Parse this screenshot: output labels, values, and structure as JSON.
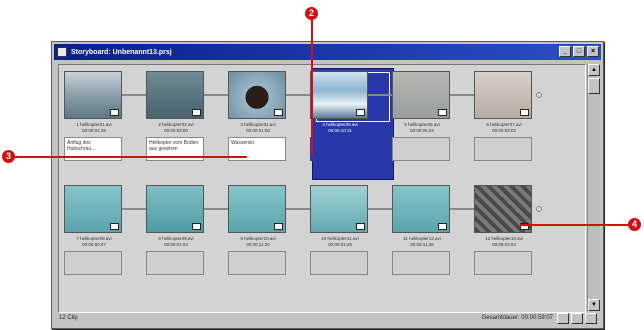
{
  "window": {
    "title": "Storyboard: Unbenannt13.prsj"
  },
  "callouts": [
    "2",
    "3",
    "4"
  ],
  "row1": [
    {
      "name": "1 helikopter01.avi",
      "time": "00:00:04:26",
      "note": "Anflug des Hubschrau...",
      "scene": "heli-lake"
    },
    {
      "name": "2 helikopter02.avi",
      "time": "00:00:03:00",
      "note": "Helikopter vom Boden aus gesehen",
      "scene": "water"
    },
    {
      "name": "3 helikopter04.avi",
      "time": "00:00:01:00",
      "note": "Wasserski",
      "scene": "person"
    },
    {
      "name": "4 helikopter05.avi",
      "time": "00:00:10:11",
      "note": "",
      "scene": "snow-mountain"
    },
    {
      "name": "5 helikopter06.avi",
      "time": "00:00:05:24",
      "note": "",
      "scene": "heli-red"
    },
    {
      "name": "6 helikopter07.avi",
      "time": "00:00:03:02",
      "note": "",
      "scene": "heli-red2"
    }
  ],
  "row2": [
    {
      "name": "7 helikopter08.avi",
      "time": "00:00:00:07",
      "note": "",
      "scene": "sea"
    },
    {
      "name": "8 helikopter09.avi",
      "time": "00:00:01:04",
      "note": "",
      "scene": "sea-boat"
    },
    {
      "name": "9 helikopter10.avi",
      "time": "00:00:11:20",
      "note": "",
      "scene": "sea"
    },
    {
      "name": "10 helikopter11.avi",
      "time": "00:00:01:29",
      "note": "",
      "scene": "sea-heli"
    },
    {
      "name": "11 helikopter12.avi",
      "time": "00:00:11:26",
      "note": "",
      "scene": "sea"
    },
    {
      "name": "12 helikopter13.avi",
      "time": "00:00:03:04",
      "note": "",
      "scene": "rocks"
    }
  ],
  "status": {
    "left": "12 Clip",
    "right": "Gesamtdauer: 00:00:59:07"
  },
  "colors": {
    "selection": "#2838a8",
    "callout": "#d21010",
    "titlebar": "#0a1f8a"
  }
}
